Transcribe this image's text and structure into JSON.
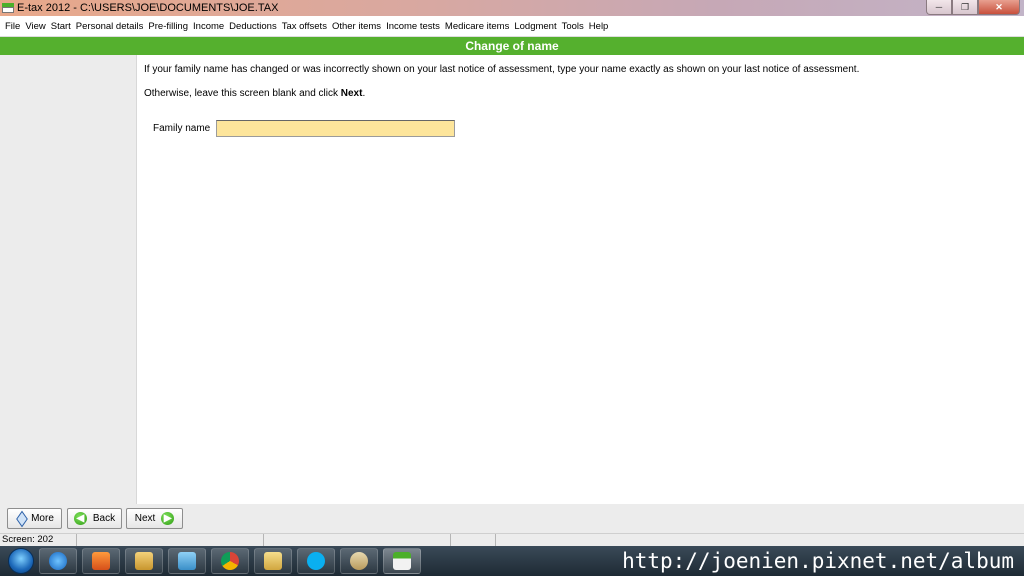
{
  "window": {
    "title": "E-tax 2012 - C:\\USERS\\JOE\\DOCUMENTS\\JOE.TAX",
    "controls": {
      "minimize": "─",
      "maximize": "❐",
      "close": "✕"
    }
  },
  "menu": {
    "items": [
      "File",
      "View",
      "Start",
      "Personal details",
      "Pre-filling",
      "Income",
      "Deductions",
      "Tax offsets",
      "Other items",
      "Income tests",
      "Medicare items",
      "Lodgment",
      "Tools",
      "Help"
    ]
  },
  "page": {
    "title": "Change of name",
    "instruction1": "If your family name has changed or was incorrectly shown on your last notice of assessment, type your name exactly as shown on your last notice of assessment.",
    "instruction2_prefix": "Otherwise, leave this screen blank and click ",
    "instruction2_bold": "Next",
    "instruction2_suffix": ".",
    "field": {
      "label": "Family name",
      "value": "",
      "placeholder": ""
    }
  },
  "buttons": {
    "more": "More",
    "back": "Back",
    "next": "Next"
  },
  "status": {
    "screen": "Screen: 202"
  },
  "taskbar": {
    "apps": [
      "internet-explorer-icon",
      "media-player-icon",
      "file-cabinet-icon",
      "app-icon",
      "chrome-icon",
      "folder-icon",
      "skype-icon",
      "paint-icon",
      "e-tax-icon"
    ],
    "watermark": "http://joenien.pixnet.net/album"
  },
  "colors": {
    "header_green": "#55b02e",
    "input_yellow": "#fde59b"
  }
}
